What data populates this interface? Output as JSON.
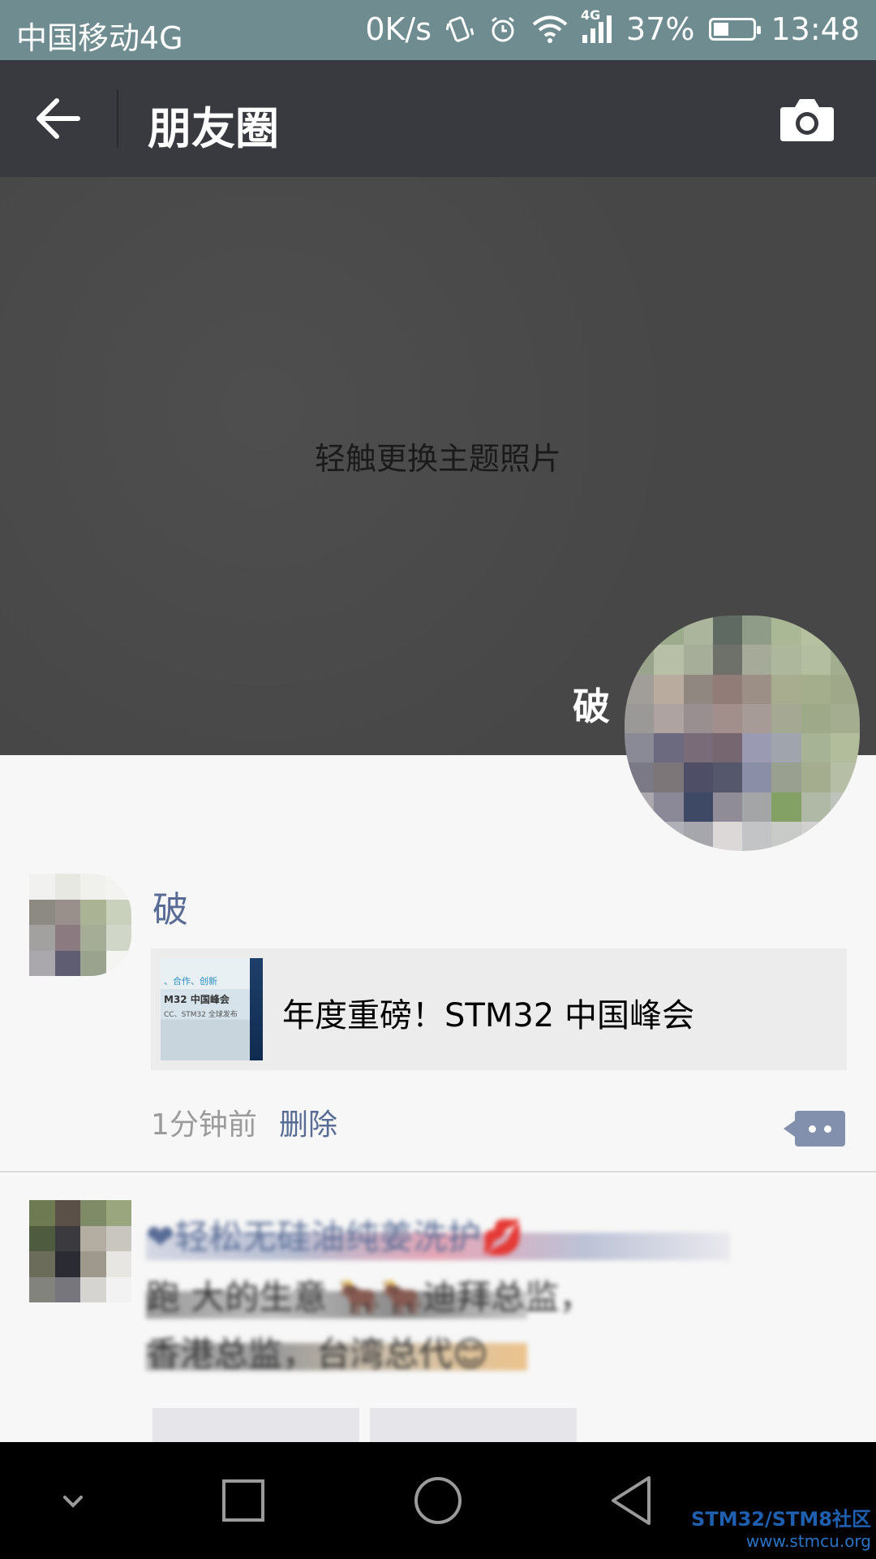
{
  "status_bar": {
    "carrier": "中国移动4G",
    "speed": "0K/s",
    "network_type": "4G",
    "battery": "37%",
    "battery_level": 0.37,
    "time": "13:48"
  },
  "header": {
    "title": "朋友圈",
    "back_icon": "arrow-left-icon",
    "camera_icon": "camera-icon"
  },
  "cover": {
    "hint": "轻触更换主题照片",
    "user_name": "破"
  },
  "moment": {
    "user_name": "破",
    "link_title": "年度重磅！STM32 中国峰会",
    "thumb_line1": "、合作、创新",
    "thumb_line2": "M32 中国峰会",
    "thumb_line3": "CC、STM32 全球发布",
    "time": "1分钟前",
    "delete_label": "删除"
  },
  "post2": {
    "line1": "❤轻松无硅油纯姜洗护💋",
    "line2": "跑 大的生意 🐂🐂迪拜总监，",
    "line3": "香港总监，台湾总代😊"
  },
  "watermark": {
    "line1": "STM32/STM8社区",
    "line2": "www.stmcu.org"
  },
  "colors": {
    "status_bar": "#6f8c91",
    "header": "#393a3f",
    "cover": "#474747",
    "link_name": "#576b95",
    "nav_bar": "#000000"
  }
}
